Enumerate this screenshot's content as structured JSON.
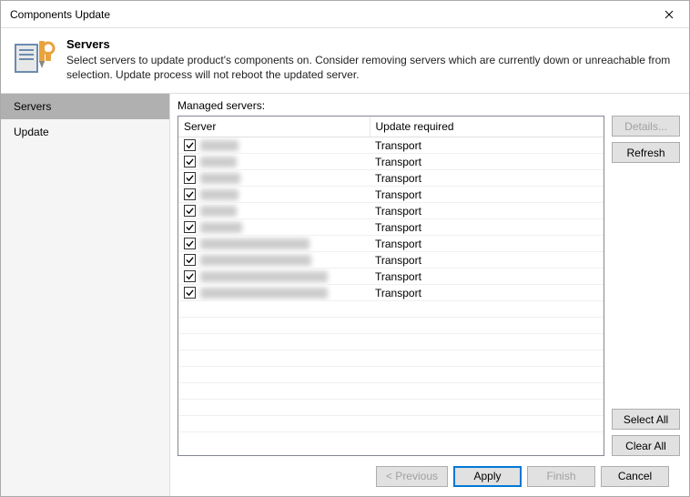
{
  "window": {
    "title": "Components Update"
  },
  "header": {
    "title": "Servers",
    "description": "Select servers to update product's components on. Consider removing servers which are currently down or unreachable from selection. Update process will not reboot the updated server."
  },
  "sidebar": {
    "items": [
      {
        "label": "Servers",
        "selected": true
      },
      {
        "label": "Update",
        "selected": false
      }
    ]
  },
  "main": {
    "label": "Managed servers:",
    "columns": {
      "server": "Server",
      "update": "Update required"
    },
    "rows": [
      {
        "checked": true,
        "server_blur_w": 42,
        "update": "Transport"
      },
      {
        "checked": true,
        "server_blur_w": 40,
        "update": "Transport"
      },
      {
        "checked": true,
        "server_blur_w": 44,
        "update": "Transport"
      },
      {
        "checked": true,
        "server_blur_w": 42,
        "update": "Transport"
      },
      {
        "checked": true,
        "server_blur_w": 40,
        "update": "Transport"
      },
      {
        "checked": true,
        "server_blur_w": 46,
        "update": "Transport"
      },
      {
        "checked": true,
        "server_blur_w": 120,
        "update": "Transport"
      },
      {
        "checked": true,
        "server_blur_w": 122,
        "update": "Transport"
      },
      {
        "checked": true,
        "server_blur_w": 140,
        "update": "Transport"
      },
      {
        "checked": true,
        "server_blur_w": 140,
        "update": "Transport"
      }
    ],
    "empty_rows": 8
  },
  "buttons": {
    "details": "Details...",
    "refresh": "Refresh",
    "select_all": "Select All",
    "clear_all": "Clear All",
    "previous": "< Previous",
    "apply": "Apply",
    "finish": "Finish",
    "cancel": "Cancel"
  }
}
